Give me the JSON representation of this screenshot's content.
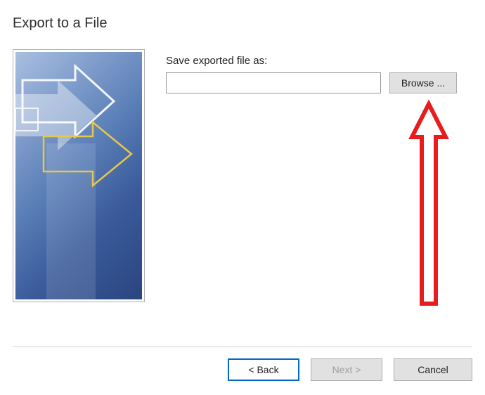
{
  "dialog": {
    "title": "Export to a File"
  },
  "form": {
    "label": "Save exported file as:",
    "file_value": "",
    "browse_label": "Browse ..."
  },
  "buttons": {
    "back": "< Back",
    "next": "Next >",
    "cancel": "Cancel"
  }
}
